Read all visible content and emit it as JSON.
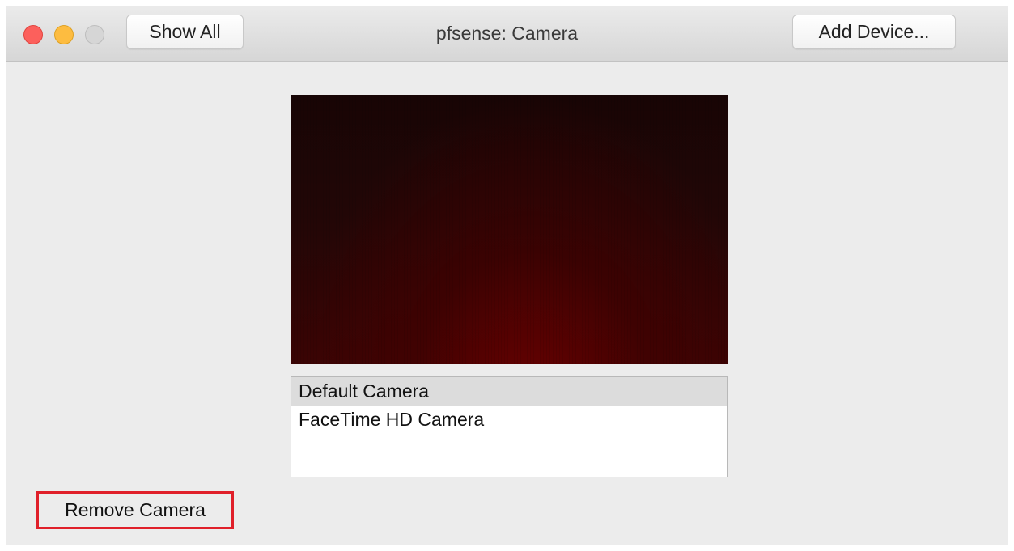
{
  "window": {
    "title": "pfsense: Camera"
  },
  "toolbar": {
    "show_all_label": "Show All",
    "add_device_label": "Add Device..."
  },
  "camera_list": {
    "items": [
      {
        "label": "Default Camera",
        "selected": true
      },
      {
        "label": "FaceTime HD Camera",
        "selected": false
      }
    ]
  },
  "actions": {
    "remove_camera_label": "Remove Camera"
  },
  "colors": {
    "close": "#fc605c",
    "minimize": "#fdbc40",
    "zoom_disabled": "#d6d6d6",
    "highlight_border": "#e0202a",
    "preview_tint": "#3a0404"
  },
  "icons": {
    "close": "close-traffic-light-icon",
    "minimize": "minimize-traffic-light-icon",
    "zoom": "zoom-traffic-light-icon"
  }
}
